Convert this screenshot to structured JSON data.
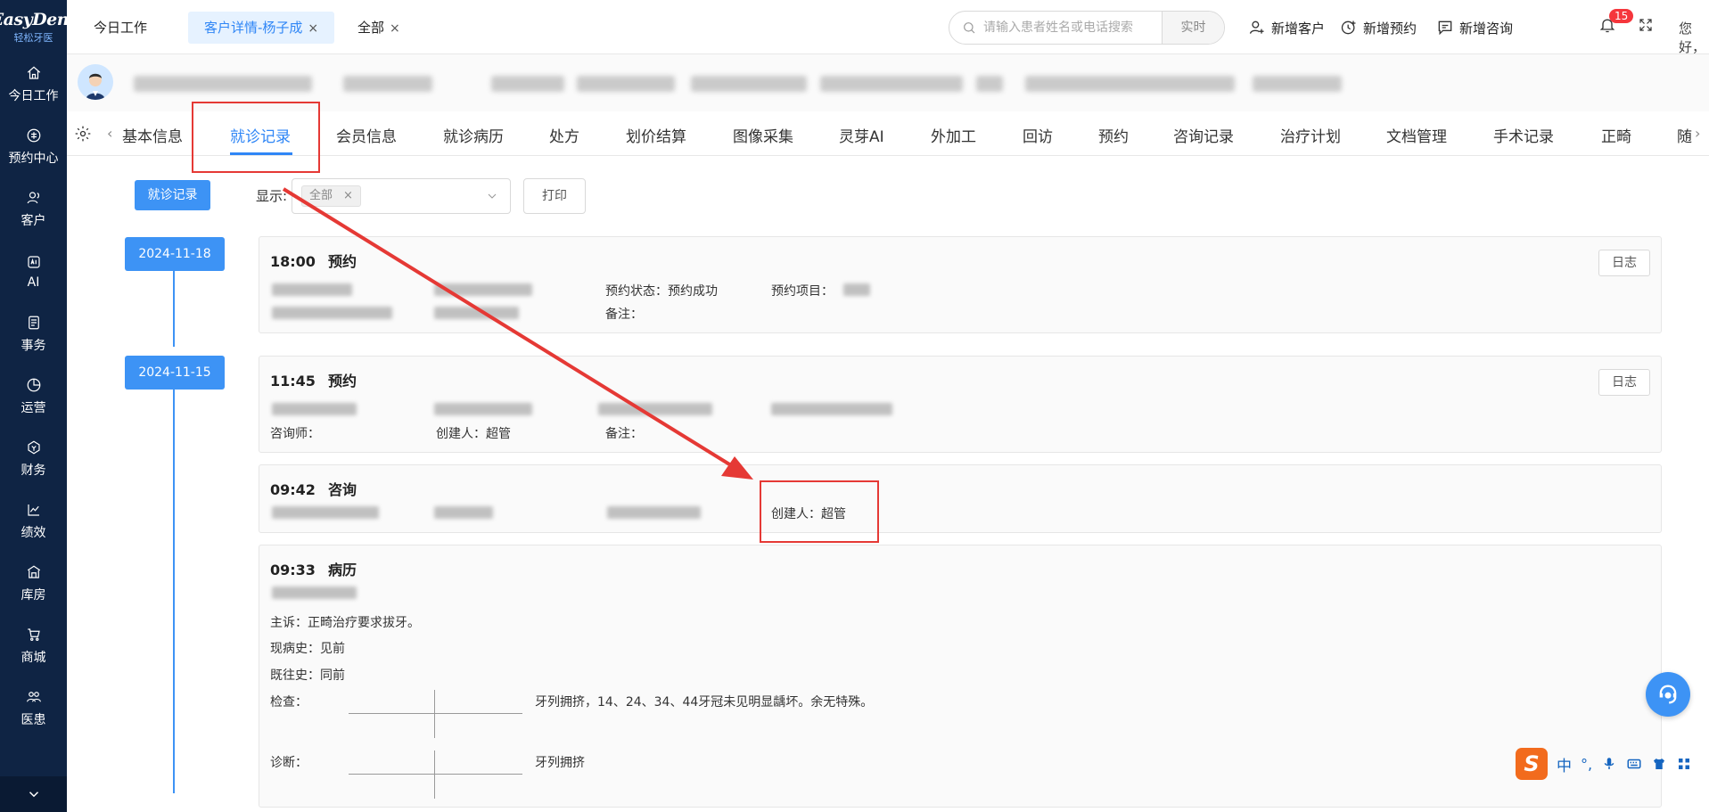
{
  "brand": {
    "logo_text": "EasyDent",
    "logo_sub": "轻松牙医"
  },
  "sidebar": {
    "items": [
      {
        "label": "今日工作",
        "icon": "home-icon"
      },
      {
        "label": "预约中心",
        "icon": "calendar-icon"
      },
      {
        "label": "客户",
        "icon": "users-icon"
      },
      {
        "label": "AI",
        "icon": "ai-icon"
      },
      {
        "label": "事务",
        "icon": "task-icon"
      },
      {
        "label": "运营",
        "icon": "pie-chart-icon"
      },
      {
        "label": "财务",
        "icon": "wallet-icon"
      },
      {
        "label": "绩效",
        "icon": "line-chart-icon"
      },
      {
        "label": "库房",
        "icon": "warehouse-icon"
      },
      {
        "label": "商城",
        "icon": "cart-icon"
      },
      {
        "label": "医患",
        "icon": "doctor-patient-icon"
      }
    ]
  },
  "topbar": {
    "tabs": [
      {
        "label": "今日工作",
        "closable": false
      },
      {
        "label": "客户详情-杨子成",
        "closable": true
      },
      {
        "label": "全部",
        "closable": true
      }
    ],
    "close_glyph": "×",
    "search_placeholder": "请输入患者姓名或电话搜索",
    "search_mode": "实时",
    "actions": {
      "new_customer": "新增客户",
      "new_appointment": "新增预约",
      "new_consult": "新增咨询"
    },
    "notification_count": "15",
    "greeting": "您好，超管"
  },
  "record_tabs": {
    "items": [
      "基本信息",
      "就诊记录",
      "会员信息",
      "就诊病历",
      "处方",
      "划价结算",
      "图像采集",
      "灵芽AI",
      "外加工",
      "回访",
      "预约",
      "咨询记录",
      "治疗计划",
      "文档管理",
      "手术记录",
      "正畸",
      "随"
    ],
    "active_index": 1
  },
  "filters": {
    "primary_button": "就诊记录",
    "show_label": "显示:",
    "selected_chip": "全部",
    "print_button": "打印"
  },
  "timeline": {
    "dates": [
      "2024-11-18",
      "2024-11-15"
    ],
    "log_label": "日志",
    "cards": {
      "c1": {
        "time": "18:00",
        "type": "预约",
        "status_label": "预约状态：",
        "status_value": "预约成功",
        "project_label": "预约项目：",
        "remark_label": "备注："
      },
      "c2": {
        "time": "11:45",
        "type": "预约",
        "consultant_label": "咨询师：",
        "creator_label": "创建人：",
        "creator_value": "超管",
        "remark_label": "备注："
      },
      "c3": {
        "time": "09:42",
        "type": "咨询",
        "creator": "创建人：超管"
      },
      "c4": {
        "time": "09:33",
        "type": "病历",
        "chief_complaint": "主诉：正畸治疗要求拔牙。",
        "present_illness": "现病史：见前",
        "past_history": "既往史：同前",
        "exam_label": "检查：",
        "exam_text": "牙列拥挤，14、24、34、44牙冠未见明显龋坏。余无特殊。",
        "diagnosis_label": "诊断：",
        "diagnosis_text": "牙列拥挤"
      }
    }
  },
  "ime": {
    "logo": "S",
    "lang": "中",
    "punct": "°,"
  },
  "colors": {
    "sidebar": "#0f2444",
    "primary": "#3d93f5",
    "annotation": "#e53935"
  }
}
